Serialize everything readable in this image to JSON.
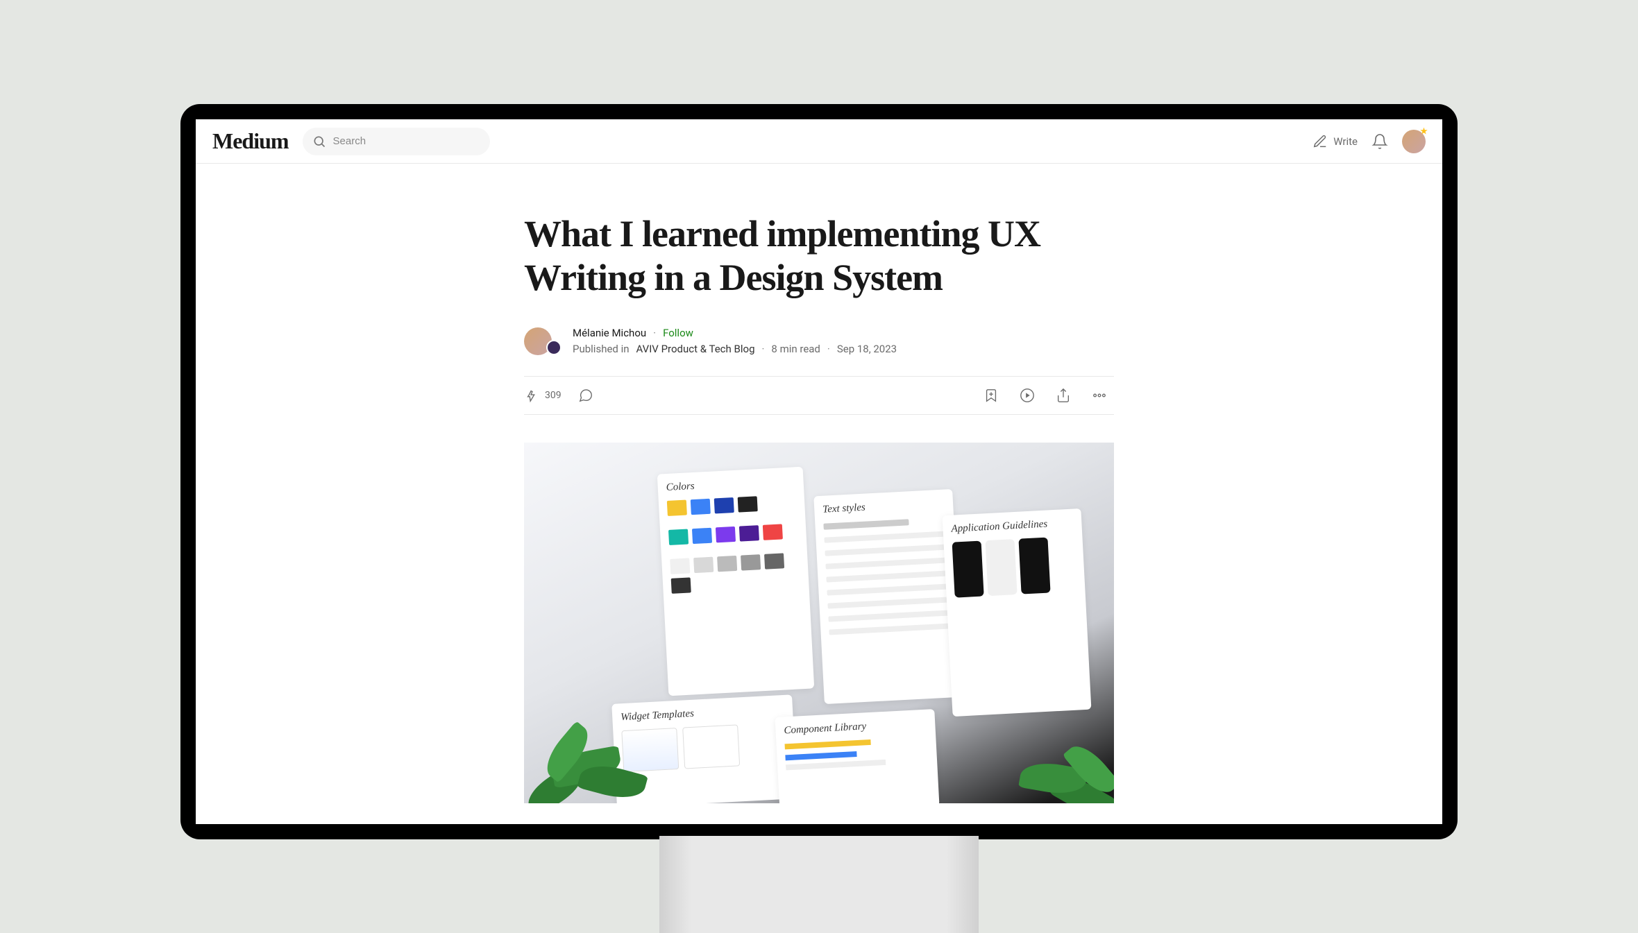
{
  "header": {
    "logo": "Medium",
    "search_placeholder": "Search",
    "write_label": "Write"
  },
  "article": {
    "title": "What I learned implementing UX Writing in a Design System",
    "author": "Mélanie Michou",
    "follow_label": "Follow",
    "published_in_prefix": "Published in",
    "publication": "AVIV Product & Tech Blog",
    "read_time": "8 min read",
    "date": "Sep 18, 2023",
    "claps": "309"
  },
  "hero": {
    "panels": {
      "colors": "Colors",
      "text_styles": "Text styles",
      "app_guidelines": "Application Guidelines",
      "widget_templates": "Widget Templates",
      "component_library": "Component Library"
    }
  }
}
